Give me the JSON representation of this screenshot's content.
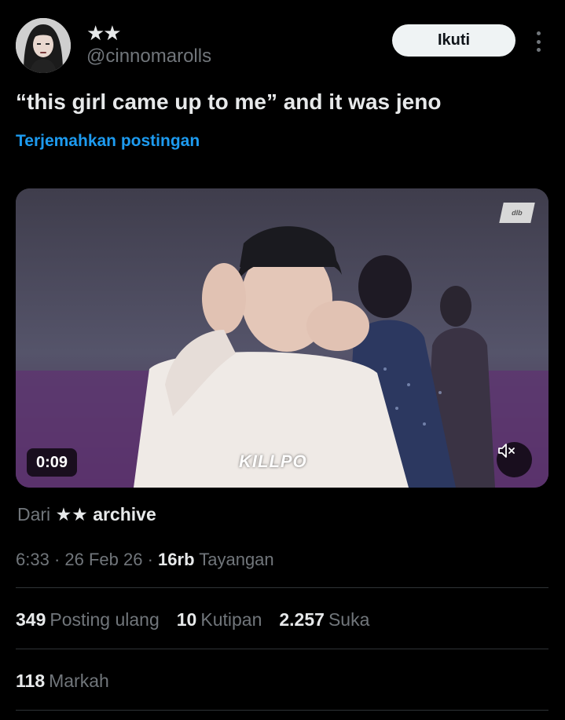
{
  "author": {
    "display_name": "★★",
    "handle": "@cinnomarolls"
  },
  "header": {
    "follow_label": "Ikuti",
    "more_icon": "more-vertical-icon"
  },
  "tweet": {
    "text": "“this girl came up to me” and it was jeno",
    "translate_label": "Terjemahkan postingan"
  },
  "video": {
    "duration": "0:09",
    "watermark": "KILLPO",
    "mute_icon": "volume-muted-icon"
  },
  "source": {
    "prefix": "Dari",
    "name": "★★ archive"
  },
  "meta": {
    "time": "6:33",
    "date": "26 Feb 26",
    "views_count": "16rb",
    "views_label": "Tayangan"
  },
  "stats": {
    "reposts_count": "349",
    "reposts_label": "Posting ulang",
    "quotes_count": "10",
    "quotes_label": "Kutipan",
    "likes_count": "2.257",
    "likes_label": "Suka",
    "bookmarks_count": "118",
    "bookmarks_label": "Markah"
  },
  "colors": {
    "background": "#000000",
    "text_primary": "#e7e9ea",
    "text_secondary": "#71767b",
    "link": "#1d9bf0",
    "divider": "#2f3336"
  }
}
